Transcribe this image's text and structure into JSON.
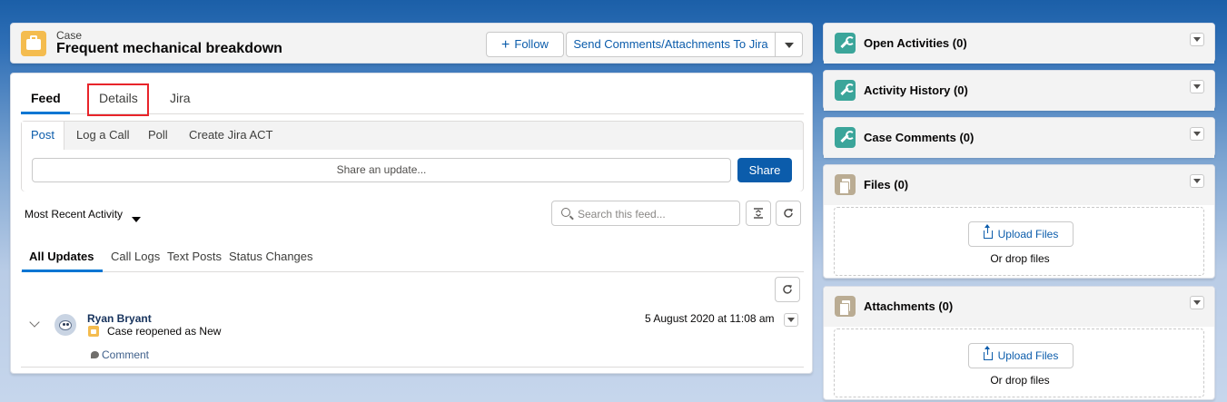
{
  "header": {
    "object_label": "Case",
    "title": "Frequent mechanical breakdown",
    "follow_label": "Follow",
    "follow_icon": "plus-icon",
    "jira_button_label": "Send Comments/Attachments To Jira"
  },
  "tabs": [
    {
      "label": "Feed",
      "active": true
    },
    {
      "label": "Details",
      "active": false
    },
    {
      "label": "Jira",
      "active": false
    }
  ],
  "publisher": {
    "tabs": [
      "Post",
      "Log a Call",
      "Poll",
      "Create Jira ACT"
    ],
    "active_tab": "Post",
    "placeholder": "Share an update...",
    "share_label": "Share"
  },
  "feed_controls": {
    "sort_label": "Most Recent Activity",
    "search_placeholder": "Search this feed..."
  },
  "filters": [
    "All Updates",
    "Call Logs",
    "Text Posts",
    "Status Changes"
  ],
  "post": {
    "author": "Ryan Bryant",
    "text": "Case reopened as New",
    "timestamp": "5 August 2020 at 11:08 am",
    "comment_label": "Comment"
  },
  "right_panels": [
    {
      "title": "Open Activities (0)",
      "icon": "wrench-icon"
    },
    {
      "title": "Activity History (0)",
      "icon": "wrench-icon"
    },
    {
      "title": "Case Comments (0)",
      "icon": "wrench-icon"
    },
    {
      "title": "Files (0)",
      "icon": "file-icon",
      "upload_label": "Upload Files",
      "drop_text": "Or drop files"
    },
    {
      "title": "Attachments (0)",
      "icon": "file-icon",
      "upload_label": "Upload Files",
      "drop_text": "Or drop files"
    }
  ],
  "colors": {
    "brand_blue": "#0b5cab",
    "active_tab_underline": "#0176d3",
    "case_icon": "#f4bc4f",
    "wrench_icon_bg": "#3ba59a",
    "file_icon_bg": "#baac93",
    "highlight_box": "#e8242a"
  }
}
